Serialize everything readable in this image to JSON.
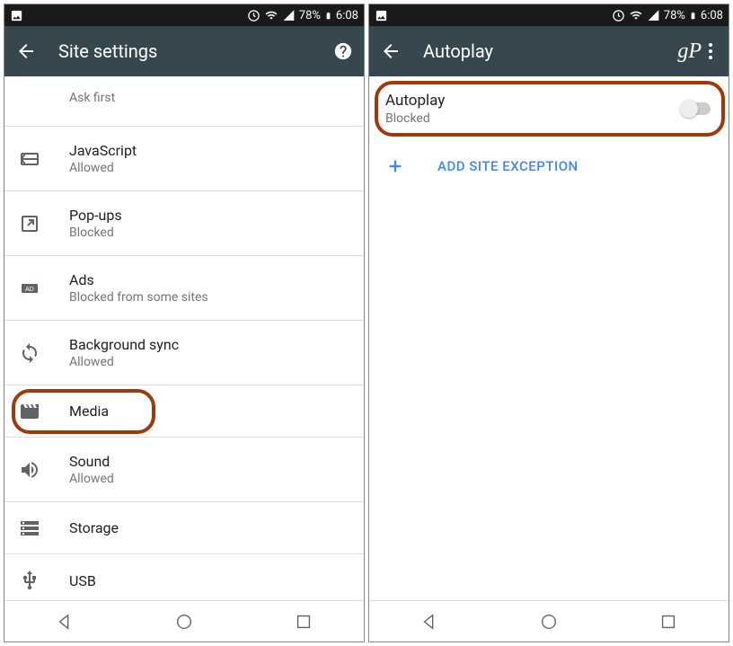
{
  "statusBar": {
    "battery_percent": "78%",
    "time": "6:08"
  },
  "screen1": {
    "title": "Site settings",
    "items": [
      {
        "title": "",
        "subtitle": "Ask first",
        "icon": "none",
        "short": true
      },
      {
        "title": "JavaScript",
        "subtitle": "Allowed",
        "icon": "javascript"
      },
      {
        "title": "Pop-ups",
        "subtitle": "Blocked",
        "icon": "popup"
      },
      {
        "title": "Ads",
        "subtitle": "Blocked from some sites",
        "icon": "ads"
      },
      {
        "title": "Background sync",
        "subtitle": "Allowed",
        "icon": "sync"
      },
      {
        "title": "Media",
        "subtitle": "",
        "icon": "media",
        "circled": true
      },
      {
        "title": "Sound",
        "subtitle": "Allowed",
        "icon": "sound"
      },
      {
        "title": "Storage",
        "subtitle": "",
        "icon": "storage"
      },
      {
        "title": "USB",
        "subtitle": "",
        "icon": "usb"
      }
    ]
  },
  "screen2": {
    "title": "Autoplay",
    "autoplay": {
      "title": "Autoplay",
      "subtitle": "Blocked",
      "on": false
    },
    "exception_label": "ADD SITE EXCEPTION",
    "logo": "gP"
  }
}
